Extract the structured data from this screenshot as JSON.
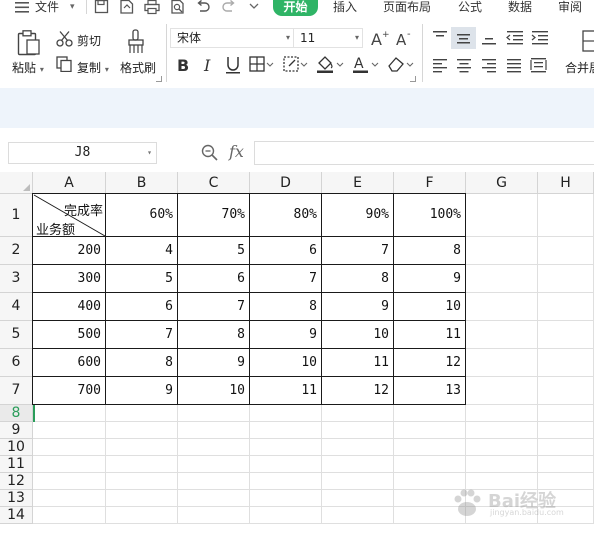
{
  "menubar": {
    "file": "文件",
    "tabs": [
      {
        "id": "home",
        "label": "开始",
        "active": true
      },
      {
        "id": "insert",
        "label": "插入"
      },
      {
        "id": "page-layout",
        "label": "页面布局"
      },
      {
        "id": "formulas",
        "label": "公式"
      },
      {
        "id": "data",
        "label": "数据"
      },
      {
        "id": "review",
        "label": "审阅"
      }
    ],
    "accent_color": "#2fb466"
  },
  "ribbon": {
    "paste": "粘贴",
    "cut": "剪切",
    "copy": "复制",
    "format_painter": "格式刷",
    "font_name": "宋体",
    "font_size": "11",
    "merge_center": "合并居"
  },
  "formula_bar": {
    "name_box": "J8",
    "fx": "fx",
    "formula": ""
  },
  "sheet": {
    "columns": [
      "A",
      "B",
      "C",
      "D",
      "E",
      "F",
      "G",
      "H"
    ],
    "rows": [
      "1",
      "2",
      "3",
      "4",
      "5",
      "6",
      "7",
      "8",
      "9",
      "10",
      "11",
      "12",
      "13",
      "14"
    ],
    "active_row": "8",
    "header_cell": {
      "top_right": "完成率",
      "bottom_left": "业务额"
    },
    "col_headers": [
      "60%",
      "70%",
      "80%",
      "90%",
      "100%"
    ],
    "data": [
      [
        "200",
        "4",
        "5",
        "6",
        "7",
        "8"
      ],
      [
        "300",
        "5",
        "6",
        "7",
        "8",
        "9"
      ],
      [
        "400",
        "6",
        "7",
        "8",
        "9",
        "10"
      ],
      [
        "500",
        "7",
        "8",
        "9",
        "10",
        "11"
      ],
      [
        "600",
        "8",
        "9",
        "10",
        "11",
        "12"
      ],
      [
        "700",
        "9",
        "10",
        "11",
        "12",
        "13"
      ]
    ]
  },
  "watermark": {
    "text": "Bai经验",
    "sub": "jingyan.baidu.com"
  }
}
